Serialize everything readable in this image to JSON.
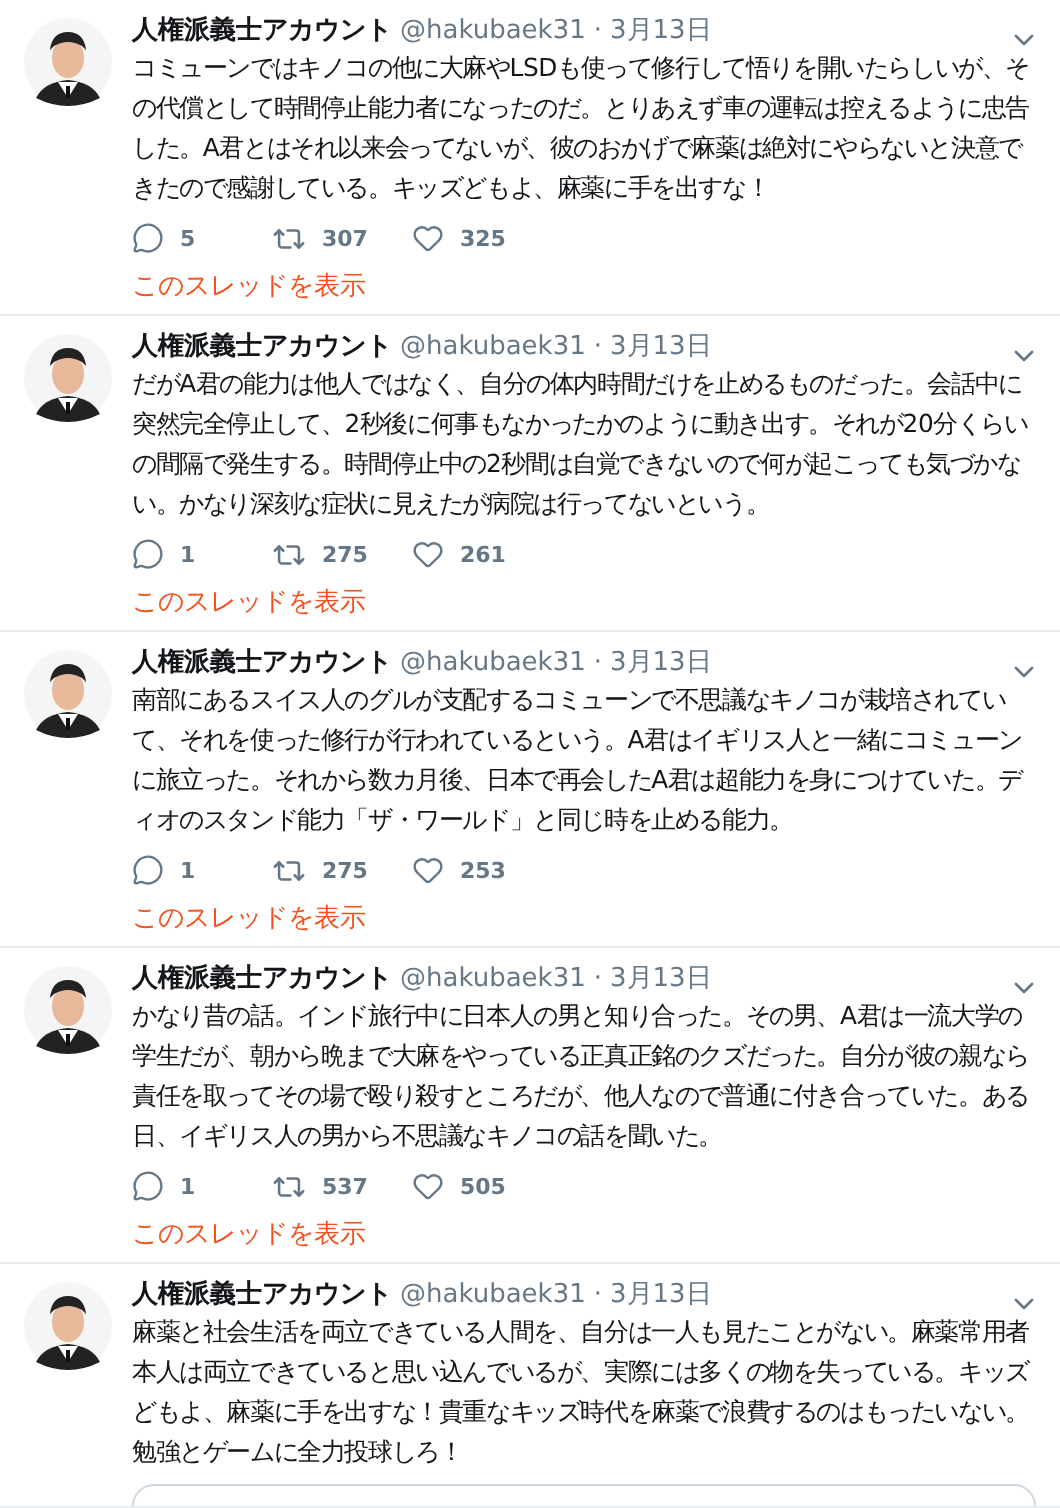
{
  "tweets": [
    {
      "name": "人権派義士アカウント",
      "handle": "@hakubaek31",
      "separator": "·",
      "date": "3月13日",
      "text": "コミューンではキノコの他に大麻やLSDも使って修行して悟りを開いたらしいが、その代償として時間停止能力者になったのだ。とりあえず車の運転は控えるように忠告した。A君とはそれ以来会ってないが、彼のおかげで麻薬は絶対にやらないと決意できたので感謝している。キッズどもよ、麻薬に手を出すな！",
      "replies": "5",
      "retweets": "307",
      "likes": "325",
      "thread_link": "このスレッドを表示",
      "card": false
    },
    {
      "name": "人権派義士アカウント",
      "handle": "@hakubaek31",
      "separator": "·",
      "date": "3月13日",
      "text": "だがA君の能力は他人ではなく、自分の体内時間だけを止めるものだった。会話中に突然完全停止して、2秒後に何事もなかったかのように動き出す。それが20分くらいの間隔で発生する。時間停止中の2秒間は自覚できないので何が起こっても気づかない。かなり深刻な症状に見えたが病院は行ってないという。",
      "replies": "1",
      "retweets": "275",
      "likes": "261",
      "thread_link": "このスレッドを表示",
      "card": false
    },
    {
      "name": "人権派義士アカウント",
      "handle": "@hakubaek31",
      "separator": "·",
      "date": "3月13日",
      "text": "南部にあるスイス人のグルが支配するコミューンで不思議なキノコが栽培されていて、それを使った修行が行われているという。A君はイギリス人と一緒にコミューンに旅立った。それから数カ月後、日本で再会したA君は超能力を身につけていた。ディオのスタンド能力「ザ・ワールド」と同じ時を止める能力。",
      "replies": "1",
      "retweets": "275",
      "likes": "253",
      "thread_link": "このスレッドを表示",
      "card": false
    },
    {
      "name": "人権派義士アカウント",
      "handle": "@hakubaek31",
      "separator": "·",
      "date": "3月13日",
      "text": "かなり昔の話。インド旅行中に日本人の男と知り合った。その男、A君は一流大学の学生だが、朝から晩まで大麻をやっている正真正銘のクズだった。自分が彼の親なら責任を取ってその場で殴り殺すところだが、他人なので普通に付き合っていた。ある日、イギリス人の男から不思議なキノコの話を聞いた。",
      "replies": "1",
      "retweets": "537",
      "likes": "505",
      "thread_link": "このスレッドを表示",
      "card": false
    },
    {
      "name": "人権派義士アカウント",
      "handle": "@hakubaek31",
      "separator": "·",
      "date": "3月13日",
      "text": "麻薬と社会生活を両立できている人間を、自分は一人も見たことがない。麻薬常用者本人は両立できていると思い込んでいるが、実際には多くの物を失っている。キッズどもよ、麻薬に手を出すな！貴重なキッズ時代を麻薬で浪費するのはもったいない。勉強とゲームに全力投球しろ！",
      "card": true
    }
  ]
}
